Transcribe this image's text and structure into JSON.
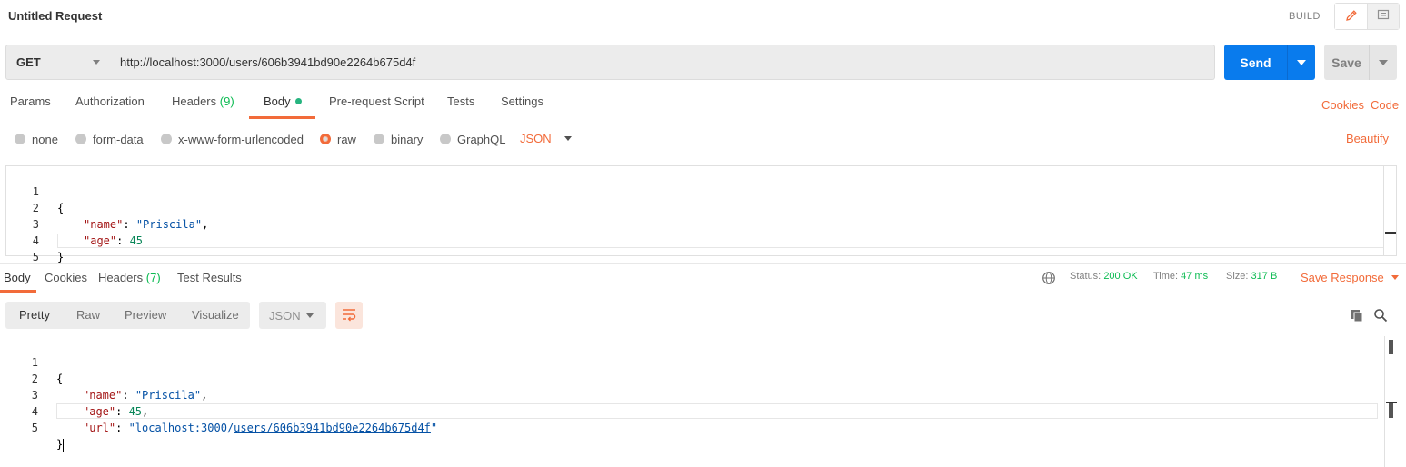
{
  "title": "Untitled Request",
  "mode_label": "BUILD",
  "request": {
    "method": "GET",
    "url": "http://localhost:3000/users/606b3941bd90e2264b675d4f",
    "send_label": "Send",
    "save_label": "Save"
  },
  "request_tabs": {
    "params": "Params",
    "authorization": "Authorization",
    "headers": "Headers",
    "headers_count": "(9)",
    "body": "Body",
    "prerequest": "Pre-request Script",
    "tests": "Tests",
    "settings": "Settings",
    "cookies_link": "Cookies",
    "code_link": "Code"
  },
  "body_types": {
    "none": "none",
    "form_data": "form-data",
    "urlencoded": "x-www-form-urlencoded",
    "raw": "raw",
    "binary": "binary",
    "graphql": "GraphQL",
    "selected": "raw",
    "language": "JSON",
    "beautify": "Beautify"
  },
  "request_body": {
    "line_numbers": [
      "1",
      "2",
      "3",
      "4",
      "5"
    ],
    "l1": "{",
    "l2_key": "\"name\"",
    "l2_sep": ": ",
    "l2_val": "\"Priscila\"",
    "l2_end": ",",
    "l3_key": "\"age\"",
    "l3_sep": ": ",
    "l3_val": "45",
    "l4": "}"
  },
  "response_tabs": {
    "body": "Body",
    "cookies": "Cookies",
    "headers": "Headers",
    "headers_count": "(7)",
    "test_results": "Test Results"
  },
  "response_status": {
    "status_label": "Status:",
    "status_value": "200 OK",
    "time_label": "Time:",
    "time_value": "47 ms",
    "size_label": "Size:",
    "size_value": "317 B",
    "save_response": "Save Response"
  },
  "response_view": {
    "pretty": "Pretty",
    "raw": "Raw",
    "preview": "Preview",
    "visualize": "Visualize",
    "format": "JSON"
  },
  "response_body": {
    "line_numbers": [
      "1",
      "2",
      "3",
      "4",
      "5"
    ],
    "l1": "{",
    "l2_key": "\"name\"",
    "l2_sep": ": ",
    "l2_val": "\"Priscila\"",
    "l2_end": ",",
    "l3_key": "\"age\"",
    "l3_sep": ": ",
    "l3_val": "45",
    "l3_end": ",",
    "l4_key": "\"url\"",
    "l4_sep": ": ",
    "l4_val_prefix": "\"localhost:3000/",
    "l4_val_link": "users/606b3941bd90e2264b675d4f",
    "l4_val_suffix": "\"",
    "l5": "}"
  },
  "colors": {
    "accent": "#f26b3a",
    "send_blue": "#097bed",
    "success_green": "#0cbb52",
    "json_key": "#a31515",
    "json_string": "#0451a5",
    "json_number": "#098658"
  },
  "icons": [
    "pencil-icon",
    "comment-icon",
    "globe-icon",
    "wrap-lines-icon",
    "copy-icon",
    "search-icon"
  ]
}
